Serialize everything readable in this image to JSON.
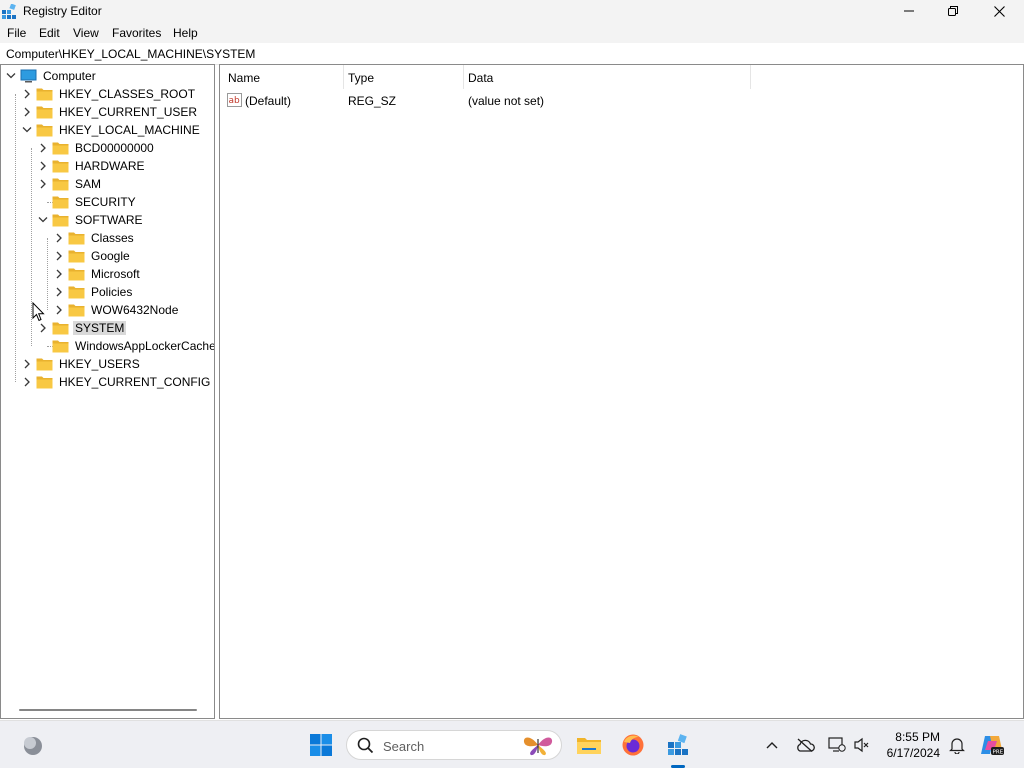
{
  "window": {
    "title": "Registry Editor",
    "icon": "registry-editor-icon"
  },
  "menu": [
    "File",
    "Edit",
    "View",
    "Favorites",
    "Help"
  ],
  "address": "Computer\\HKEY_LOCAL_MACHINE\\SYSTEM",
  "tree": [
    {
      "label": "Computer",
      "level": 0,
      "expander": "expanded",
      "icon": "computer-icon"
    },
    {
      "label": "HKEY_CLASSES_ROOT",
      "level": 1,
      "expander": "collapsed",
      "icon": "folder-icon"
    },
    {
      "label": "HKEY_CURRENT_USER",
      "level": 1,
      "expander": "collapsed",
      "icon": "folder-icon"
    },
    {
      "label": "HKEY_LOCAL_MACHINE",
      "level": 1,
      "expander": "expanded",
      "icon": "folder-icon"
    },
    {
      "label": "BCD00000000",
      "level": 2,
      "expander": "collapsed",
      "icon": "folder-icon"
    },
    {
      "label": "HARDWARE",
      "level": 2,
      "expander": "collapsed",
      "icon": "folder-icon"
    },
    {
      "label": "SAM",
      "level": 2,
      "expander": "collapsed",
      "icon": "folder-icon"
    },
    {
      "label": "SECURITY",
      "level": 2,
      "expander": "none",
      "icon": "folder-icon"
    },
    {
      "label": "SOFTWARE",
      "level": 2,
      "expander": "expanded",
      "icon": "folder-icon"
    },
    {
      "label": "Classes",
      "level": 3,
      "expander": "collapsed",
      "icon": "folder-icon"
    },
    {
      "label": "Google",
      "level": 3,
      "expander": "collapsed",
      "icon": "folder-icon"
    },
    {
      "label": "Microsoft",
      "level": 3,
      "expander": "collapsed",
      "icon": "folder-icon"
    },
    {
      "label": "Policies",
      "level": 3,
      "expander": "collapsed",
      "icon": "folder-icon"
    },
    {
      "label": "WOW6432Node",
      "level": 3,
      "expander": "collapsed",
      "icon": "folder-icon"
    },
    {
      "label": "SYSTEM",
      "level": 2,
      "expander": "collapsed",
      "icon": "folder-icon",
      "selected": true
    },
    {
      "label": "WindowsAppLockerCache",
      "level": 2,
      "expander": "none",
      "icon": "folder-icon"
    },
    {
      "label": "HKEY_USERS",
      "level": 1,
      "expander": "collapsed",
      "icon": "folder-icon"
    },
    {
      "label": "HKEY_CURRENT_CONFIG",
      "level": 1,
      "expander": "collapsed",
      "icon": "folder-icon"
    }
  ],
  "list": {
    "columns": [
      "Name",
      "Type",
      "Data"
    ],
    "rows": [
      {
        "name": "(Default)",
        "type": "REG_SZ",
        "data": "(value not set)",
        "icon": "string-value-icon"
      }
    ]
  },
  "taskbar": {
    "search_placeholder": "Search",
    "time": "8:55 PM",
    "date": "6/17/2024"
  },
  "colors": {
    "selection": "#d9d9d9",
    "folder": "#f8c843",
    "accent": "#0067c0"
  }
}
